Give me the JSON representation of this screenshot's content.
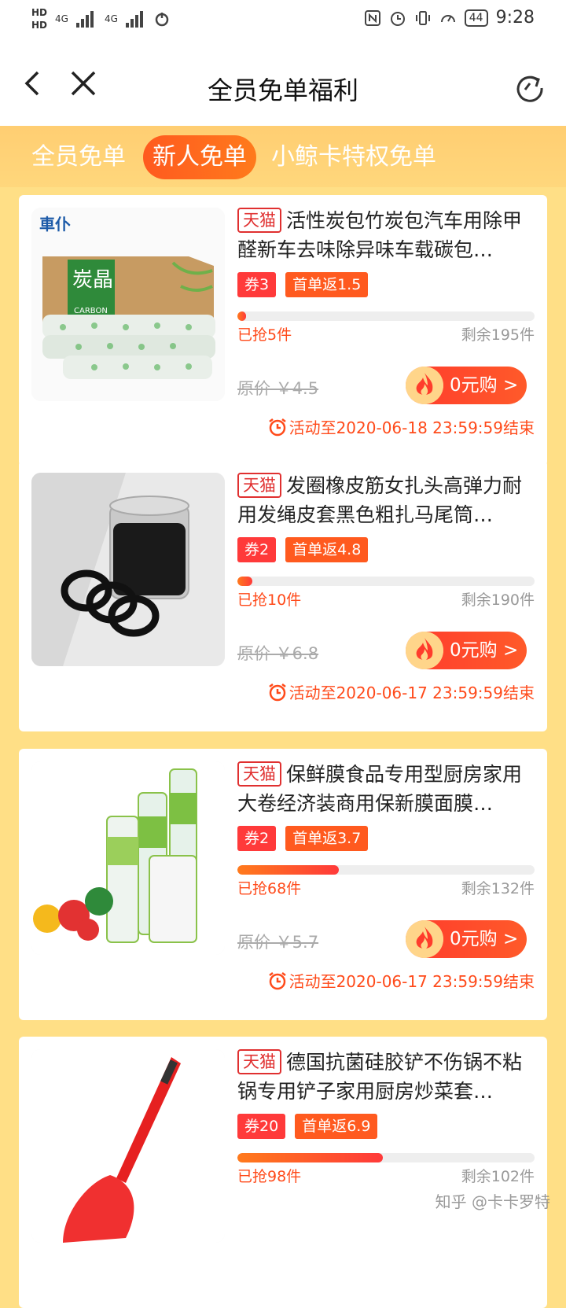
{
  "status_bar": {
    "time": "9:28",
    "battery": "44",
    "left_labels": [
      "HD",
      "HD"
    ],
    "network_labels": [
      "4G",
      "4G"
    ]
  },
  "nav": {
    "title": "全员免单福利",
    "icons": {
      "back": "chevron-left-icon",
      "close": "close-icon",
      "refresh": "refresh-icon"
    }
  },
  "tabs": [
    {
      "label": "全员免单",
      "active": false
    },
    {
      "label": "新人免单",
      "active": true
    },
    {
      "label": "小鲸卡特权免单",
      "active": false
    }
  ],
  "products": [
    {
      "shop_tag": "天猫",
      "title": "活性炭包竹炭包汽车用除甲醛新车去味除异味车载碳包…",
      "coupon": "券3",
      "rebate": "首单返1.5",
      "progress": 0.03,
      "grabbed": "已抢5件",
      "remaining": "剩余195件",
      "original_price": "原价 ￥4.5",
      "buy_label": "0元购 >",
      "deadline": "活动至2020-06-18 23:59:59结束",
      "image_labels": {
        "brand": "車仆",
        "box_text": "炭晶",
        "sub_text": "CARBON"
      }
    },
    {
      "shop_tag": "天猫",
      "title": "发圈橡皮筋女扎头高弹力耐用发绳皮套黑色粗扎马尾筒…",
      "coupon": "券2",
      "rebate": "首单返4.8",
      "progress": 0.05,
      "grabbed": "已抢10件",
      "remaining": "剩余190件",
      "original_price": "原价 ￥6.8",
      "buy_label": "0元购 >",
      "deadline": "活动至2020-06-17 23:59:59结束",
      "image_labels": {}
    },
    {
      "shop_tag": "天猫",
      "title": "保鲜膜食品专用型厨房家用大卷经济装商用保新膜面膜…",
      "coupon": "券2",
      "rebate": "首单返3.7",
      "progress": 0.34,
      "grabbed": "已抢68件",
      "remaining": "剩余132件",
      "original_price": "原价 ￥5.7",
      "buy_label": "0元购 >",
      "deadline": "活动至2020-06-17 23:59:59结束",
      "image_labels": {}
    },
    {
      "shop_tag": "天猫",
      "title": "德国抗菌硅胶铲不伤锅不粘锅专用铲子家用厨房炒菜套…",
      "coupon": "券20",
      "rebate": "首单返6.9",
      "progress": 0.49,
      "grabbed": "已抢98件",
      "remaining": "剩余102件",
      "original_price": "",
      "buy_label": "",
      "deadline": "",
      "image_labels": {}
    }
  ],
  "watermark": "知乎 @卡卡罗特",
  "colors": {
    "accent": "#ff5a1f",
    "red": "#ff3a3a",
    "page_bg": "#ffdf86",
    "tab_bg": "#ffce72"
  }
}
